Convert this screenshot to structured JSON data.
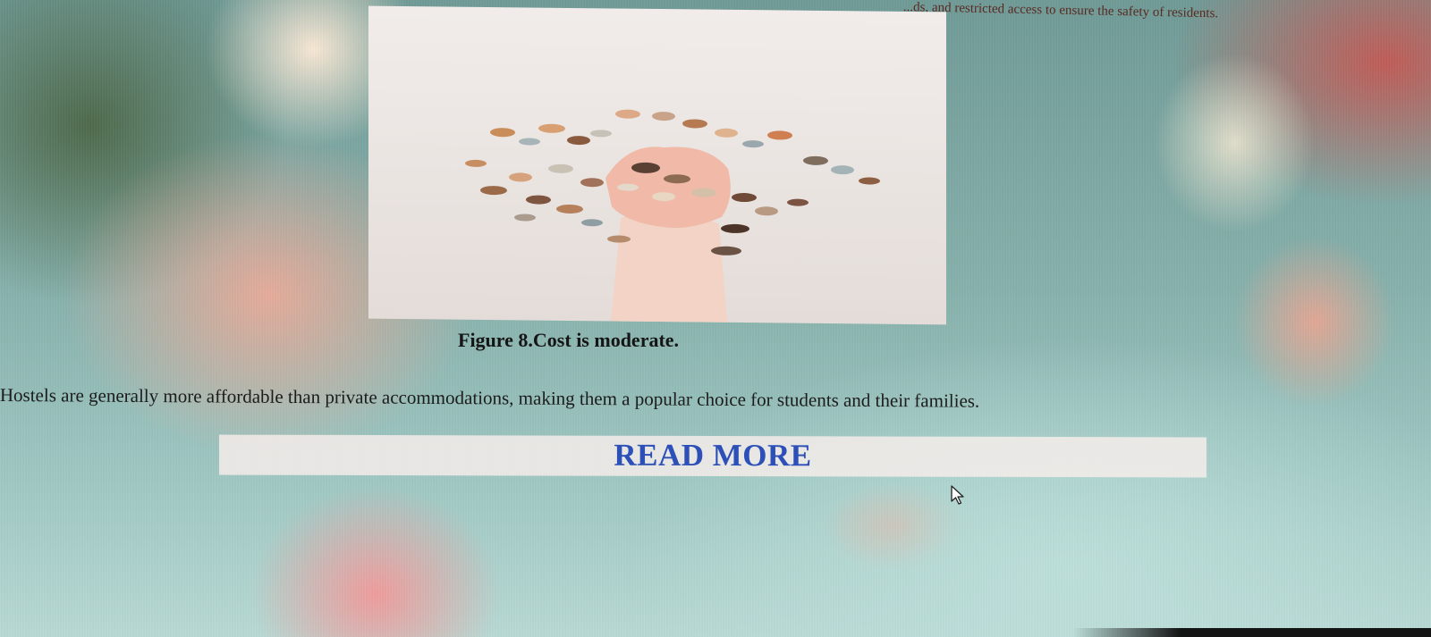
{
  "article": {
    "top_text": "...ds, and restricted access to ensure the safety of residents.",
    "figure": {
      "image_subject": "hand holding coins",
      "caption": "Figure 8.Cost is moderate."
    },
    "paragraph": "Hostels are generally more affordable than private accommodations, making them a popular choice for students and their families.",
    "read_more_label": "READ MORE"
  },
  "colors": {
    "link": "#2c4fb8",
    "text": "#1c1c1c",
    "read_more_bar": "#f8eeec"
  },
  "icons": {
    "cursor": "arrow-cursor-icon"
  }
}
